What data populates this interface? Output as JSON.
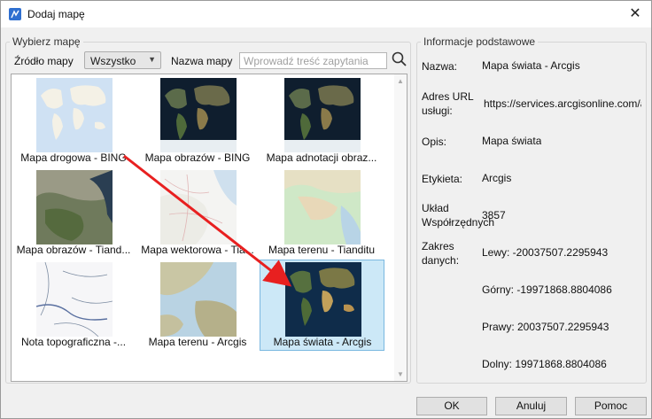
{
  "window": {
    "title": "Dodaj mapę"
  },
  "left": {
    "group_title": "Wybierz mapę",
    "source_label": "Źródło mapy",
    "source_value": "Wszystko",
    "name_label": "Nazwa mapy",
    "search_placeholder": "Wprowadź treść zapytania"
  },
  "tiles": [
    {
      "label": "Mapa drogowa - BING",
      "thumb": "roadmap"
    },
    {
      "label": "Mapa obrazów - BING",
      "thumb": "imagery"
    },
    {
      "label": "Mapa adnotacji obraz...",
      "thumb": "imagery"
    },
    {
      "label": "Mapa obrazów - Tiand...",
      "thumb": "tianditu-imagery"
    },
    {
      "label": "Mapa wektorowa - Tia...",
      "thumb": "tianditu-vector"
    },
    {
      "label": "Mapa terenu - Tianditu",
      "thumb": "tianditu-terrain"
    },
    {
      "label": "Nota topograficzna -...",
      "thumb": "topo-note"
    },
    {
      "label": "Mapa terenu - Arcgis",
      "thumb": "arcgis-terrain"
    },
    {
      "label": "Mapa świata - Arcgis",
      "thumb": "arcgis-world",
      "selected": true
    }
  ],
  "info": {
    "group_title": "Informacje podstawowe",
    "name_label": "Nazwa:",
    "name_value": "Mapa świata - Arcgis",
    "url_label_1": "Adres URL",
    "url_label_2": "usługi:",
    "url_value": "https://services.arcgisonline.com/a",
    "desc_label": "Opis:",
    "desc_value": "Mapa świata",
    "tag_label": "Etykieta:",
    "tag_value": "Arcgis",
    "crs_label_1": "Układ",
    "crs_label_2": "Współrzędnych",
    "crs_value": "3857",
    "extent_label_1": "Zakres",
    "extent_label_2": "danych:",
    "extent_left": "Lewy: -20037507.2295943",
    "extent_top": "Górny: -19971868.8804086",
    "extent_right": "Prawy: 20037507.2295943",
    "extent_bottom": "Dolny: 19971868.8804086"
  },
  "buttons": {
    "ok": "OK",
    "cancel": "Anuluj",
    "help": "Pomoc"
  },
  "colors": {
    "accent": "#2f6fd0",
    "selection": "#cce8f7",
    "arrow": "#e82020"
  }
}
